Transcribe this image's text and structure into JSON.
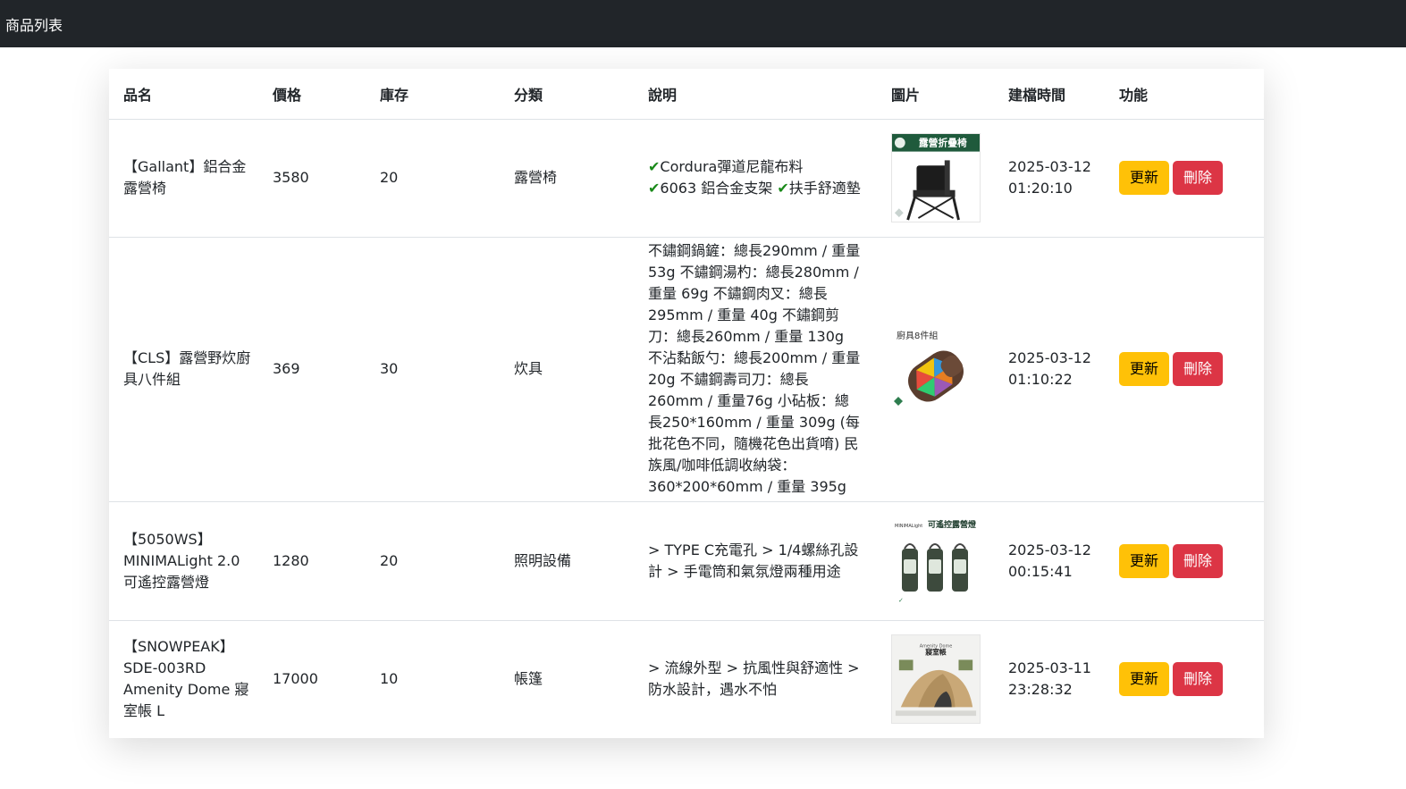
{
  "navbar": {
    "title": "商品列表"
  },
  "table": {
    "headers": {
      "name": "品名",
      "price": "價格",
      "stock": "庫存",
      "category": "分類",
      "description": "說明",
      "image": "圖片",
      "created": "建檔時間",
      "actions": "功能"
    },
    "rows": [
      {
        "name": "【Gallant】鋁合金露營椅",
        "price": "3580",
        "stock": "20",
        "category": "露營椅",
        "desc_parts": [
          "Cordura彈道尼龍布料",
          "6063 鋁合金支架",
          "扶手舒適墊"
        ],
        "image_label": "露營折疊椅",
        "created": "2025-03-12 01:20:10",
        "update_label": "更新",
        "delete_label": "刪除"
      },
      {
        "name": "【CLS】露營野炊廚具八件組",
        "price": "369",
        "stock": "30",
        "category": "炊具",
        "description": "不鏽鋼鍋鏟：總長290mm / 重量53g 不鏽鋼湯杓：總長280mm / 重量 69g 不鏽鋼肉叉：總長295mm / 重量 40g 不鏽鋼剪刀：總長260mm / 重量 130g 不沾黏飯勺：總長200mm / 重量 20g 不鏽鋼壽司刀：總長260mm / 重量76g 小砧板：總長250*160mm / 重量 309g (每批花色不同，隨機花色出貨唷) 民族風/咖啡低調收納袋：360*200*60mm / 重量 395g",
        "image_label": "廚具8件組",
        "created": "2025-03-12 01:10:22",
        "update_label": "更新",
        "delete_label": "刪除"
      },
      {
        "name": "【5050WS】MINIMALight 2.0 可遙控露營燈",
        "price": "1280",
        "stock": "20",
        "category": "照明設備",
        "description": "> TYPE C充電孔 > 1/4螺絲孔設計 > 手電筒和氣氛燈兩種用途",
        "image_label": "可遙控露營燈",
        "image_label_small": "MINIMALight",
        "created": "2025-03-12 00:15:41",
        "update_label": "更新",
        "delete_label": "刪除"
      },
      {
        "name": "【SNOWPEAK】SDE-003RD Amenity Dome 寢室帳 L",
        "price": "17000",
        "stock": "10",
        "category": "帳篷",
        "description": "> 流線外型 > 抗風性與舒適性 > 防水設計，遇水不怕",
        "image_label": "寢室帳",
        "image_label_small": "Amenity Dome",
        "created": "2025-03-11 23:28:32",
        "update_label": "更新",
        "delete_label": "刪除"
      }
    ]
  },
  "colors": {
    "navbar_bg": "#212529",
    "update_btn": "#ffc107",
    "delete_btn": "#dc3545",
    "check": "#1a8a1a"
  }
}
